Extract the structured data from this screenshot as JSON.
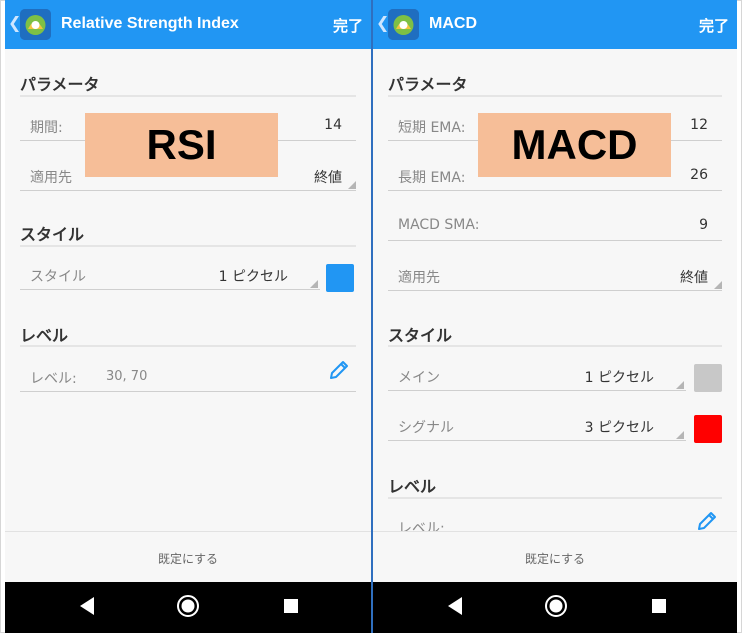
{
  "left": {
    "title": "Relative Strength Index",
    "done": "完了",
    "section_params": "パラメータ",
    "period": {
      "label": "期間:",
      "value": "14"
    },
    "apply": {
      "label": "適用先",
      "value": "終値"
    },
    "section_style": "スタイル",
    "style": {
      "label": "スタイル",
      "value": "1 ピクセル",
      "color": "#2196f3"
    },
    "section_level": "レベル",
    "level": {
      "label": "レベル:",
      "value": "30, 70"
    },
    "overlay": "RSI",
    "reset": "既定にする"
  },
  "right": {
    "title": "MACD",
    "done": "完了",
    "section_params": "パラメータ",
    "fast_ema": {
      "label": "短期 EMA:",
      "value": "12"
    },
    "slow_ema": {
      "label": "長期 EMA:",
      "value": "26"
    },
    "macd_sma": {
      "label": "MACD SMA:",
      "value": "9"
    },
    "apply": {
      "label": "適用先",
      "value": "終値"
    },
    "section_style": "スタイル",
    "main": {
      "label": "メイン",
      "value": "1 ピクセル",
      "color": "#c8c8c8"
    },
    "signal": {
      "label": "シグナル",
      "value": "3 ピクセル",
      "color": "#ff0000"
    },
    "section_level": "レベル",
    "level": {
      "label": "レベル:"
    },
    "overlay": "MACD",
    "reset": "既定にする"
  },
  "icons": {
    "back": "chevron-left-icon",
    "logo": "metatrader-logo-icon",
    "pencil": "pencil-icon",
    "nav_back": "triangle-back-icon",
    "nav_home": "circle-home-icon",
    "nav_recent": "square-recent-icon"
  }
}
